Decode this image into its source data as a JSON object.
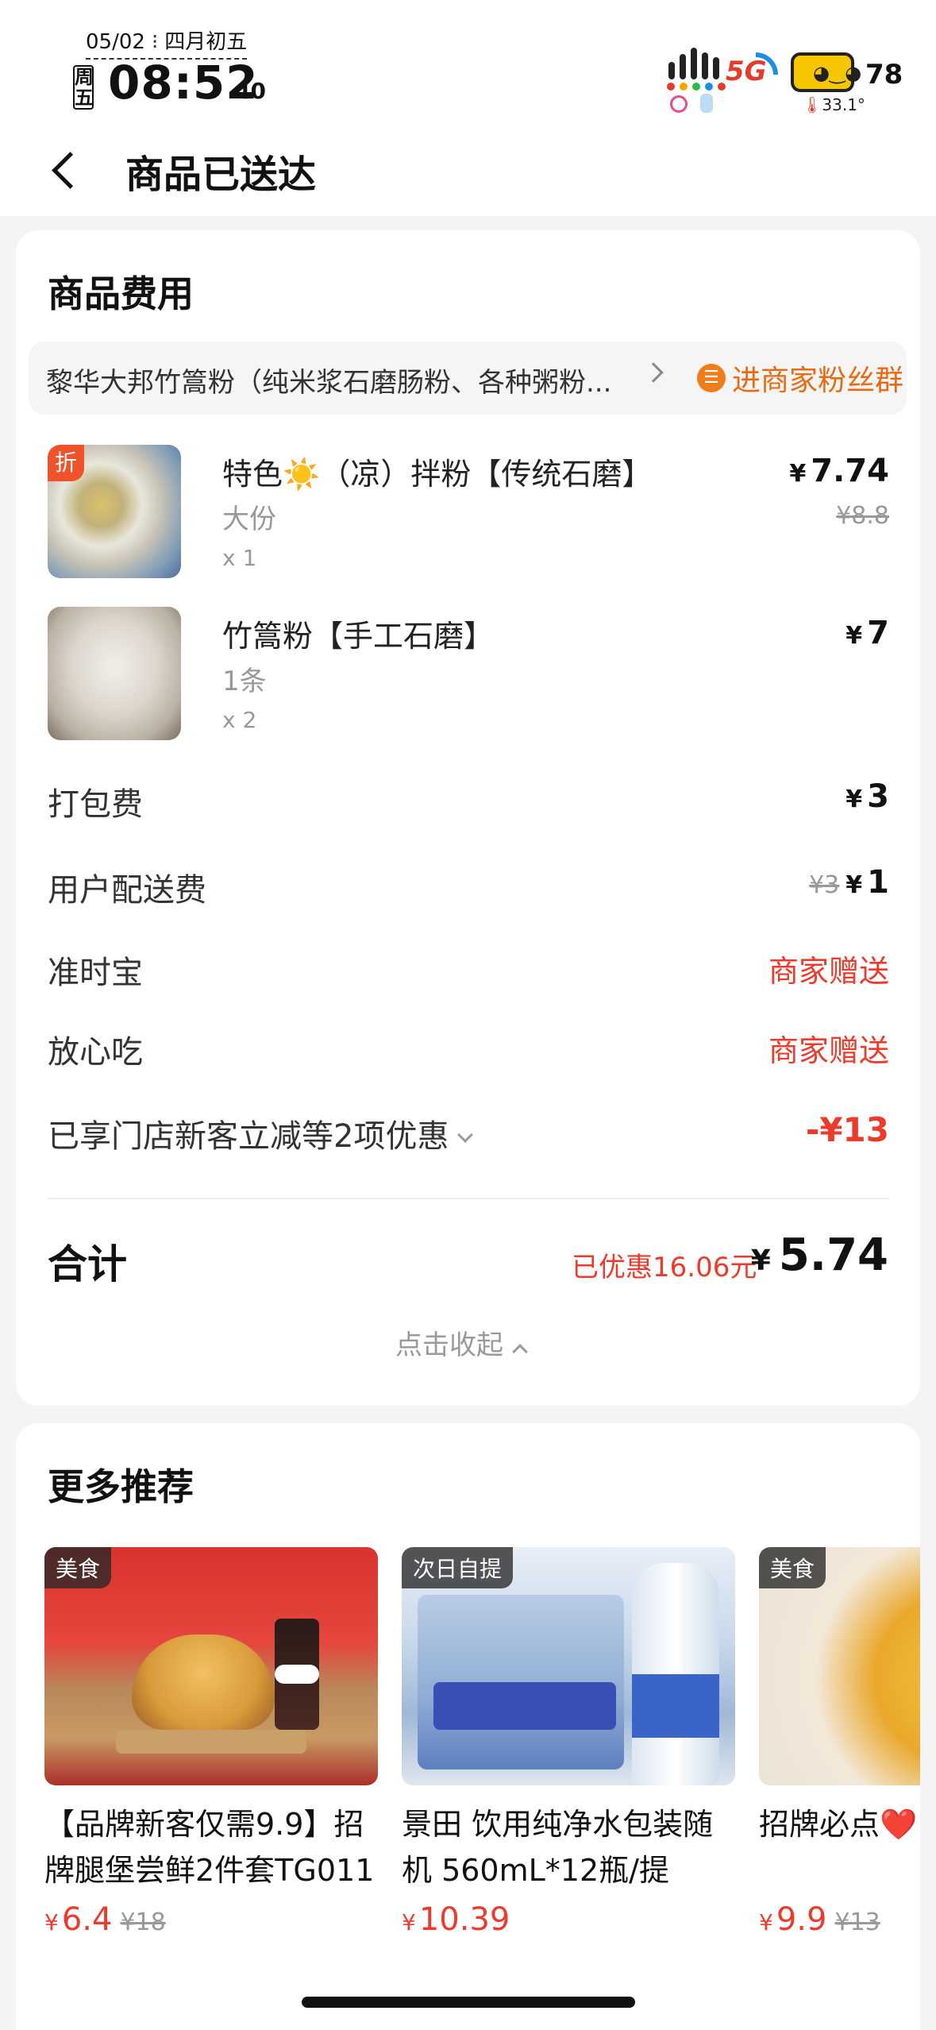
{
  "status_bar": {
    "date": "05/02",
    "lunar": "四月初五",
    "weekday": "周五",
    "time": "08:52",
    "seconds": "40",
    "network": "5G",
    "battery": "78",
    "temperature": "33.1°"
  },
  "header": {
    "title": "商品已送达"
  },
  "fees": {
    "title": "商品费用",
    "shop_name": "黎华大邦竹篙粉（纯米浆石磨肠粉、各种粥粉...",
    "fans_group_label": "进商家粉丝群",
    "items": [
      {
        "name": "特色☀️（凉）拌粉【传统石磨】",
        "spec": "大份",
        "qty": "x 1",
        "price": "7.74",
        "original": "¥8.8",
        "badge": "折"
      },
      {
        "name": "竹篙粉【手工石磨】",
        "spec": "1条",
        "qty": "x 2",
        "price": "7"
      }
    ],
    "packing": {
      "label": "打包费",
      "price": "3"
    },
    "delivery": {
      "label": "用户配送费",
      "original": "¥3",
      "price": "1"
    },
    "ontime": {
      "label": "准时宝",
      "value": "商家赠送"
    },
    "safe": {
      "label": "放心吃",
      "value": "商家赠送"
    },
    "discount": {
      "label": "已享门店新客立减等2项优惠",
      "value": "-¥13"
    },
    "total": {
      "label": "合计",
      "saved": "已优惠16.06元",
      "amount": "5.74"
    },
    "collapse_label": "点击收起",
    "currency": "¥"
  },
  "recommend": {
    "title": "更多推荐",
    "items": [
      {
        "tag": "美食",
        "title": "【品牌新客仅需9.9】招牌腿堡尝鲜2件套TG011",
        "price": "6.4",
        "original": "¥18"
      },
      {
        "tag": "次日自提",
        "title": "景田 饮用纯净水包装随机 560mL*12瓶/提",
        "price": "10.39"
      },
      {
        "tag": "美食",
        "title": "招牌必点❤️",
        "price": "9.9",
        "original": "¥13"
      }
    ]
  }
}
